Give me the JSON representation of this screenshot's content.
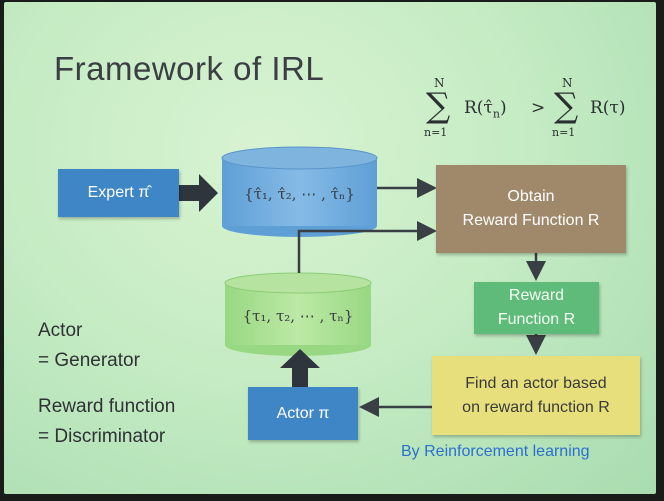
{
  "slide": {
    "title": "Framework of IRL",
    "formula": {
      "sum_upper": "N",
      "sum_lower": "n=1",
      "lhs_term": "R(τ̂",
      "lhs_sub": "n",
      "lhs_close": ")",
      "relation": ">",
      "rhs_upper": "N",
      "rhs_lower": "n=1",
      "rhs_term": "R(τ)"
    },
    "expert_box": {
      "label": "Expert π̂"
    },
    "expert_trajectories": {
      "label": "{τ̂₁, τ̂₂, ⋯ , τ̂ₙ}"
    },
    "actor_trajectories": {
      "label": "{τ₁, τ₂, ⋯ , τₙ}"
    },
    "obtain_box": {
      "line1": "Obtain",
      "line2": "Reward Function R"
    },
    "reward_box": {
      "line1": "Reward",
      "line2": "Function R"
    },
    "find_box": {
      "line1": "Find an actor based",
      "line2": "on reward function R"
    },
    "actor_box": {
      "label": "Actor π"
    },
    "side_notes": {
      "actor_label": "Actor",
      "actor_eq": "= Generator",
      "reward_label": "Reward function",
      "reward_eq": "= Discriminator"
    },
    "rl_note": "By Reinforcement learning"
  },
  "colors": {
    "background": "#c6ecc4",
    "expert_blue": "#3f86c6",
    "obtain_brown": "#a0886b",
    "reward_green": "#5fbb7a",
    "find_yellow": "#e7df7c",
    "cylinder_blue": "#6fa9d9",
    "cylinder_green": "#a8de90",
    "rl_text": "#2b6fd1",
    "arrow": "#3a3f45"
  }
}
